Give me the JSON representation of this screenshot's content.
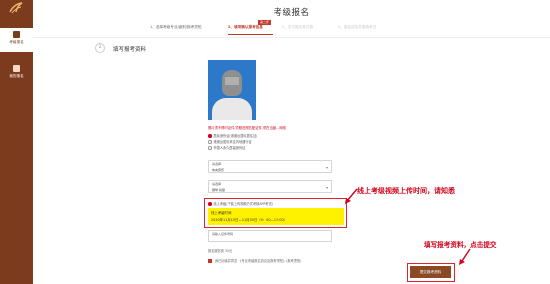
{
  "app": {
    "page_title": "考级报名"
  },
  "sidebar": {
    "items": [
      {
        "label": "考级报名",
        "icon": "registration-icon",
        "active": true
      },
      {
        "label": "我的报名",
        "icon": "list-icon",
        "active": false
      }
    ]
  },
  "steps": {
    "current_badge": "第二步",
    "items": [
      {
        "label": "1、选择考级专业/级别/报考须知",
        "state": "done"
      },
      {
        "label": "2、填写确认报考信息",
        "state": "active"
      },
      {
        "label": "3、支付报名考试费",
        "state": "todo"
      },
      {
        "label": "4、报名成功并缴纳考试",
        "state": "todo"
      }
    ]
  },
  "section": {
    "number": "2",
    "title": "填写报考资料"
  },
  "form": {
    "photo_warning": "照片须不得时证件,须照旧照匹配证件,须在当届…网络",
    "id_type_options": [
      {
        "label": "居民身份证(港澳台居民居住证)",
        "checked": true
      },
      {
        "label": "港澳台居民来往内地通行证",
        "checked": false
      },
      {
        "label": "外国人永久居留身份证",
        "checked": false
      }
    ],
    "field1": {
      "label": "请选择",
      "value": "中央音乐"
    },
    "field2": {
      "label": "请选择",
      "value": "钢琴 初级"
    },
    "exam_date_option": "线上考级(下载上传视频方式考核APP考试)",
    "exam_date_label": "线上考级时间",
    "exam_date_value": "2020年11月15日—11月30日（9：00—17:00）",
    "id_field_label": "请输入证件号码",
    "fee_text": "报名服务费 35元",
    "agree_text": "我已阅读并同意 《专业考级报名协议及报考须知》(报考须知)"
  },
  "annotations": {
    "upload_note": "线上考级视频上传时间，请知悉",
    "submit_note": "填写报考资料，点击提交"
  },
  "submit": {
    "label": "提交报考资料"
  },
  "colors": {
    "brand": "#7b3b1c",
    "accent": "#c0392b",
    "highlight": "#fff200",
    "annotation": "#d0021b"
  }
}
